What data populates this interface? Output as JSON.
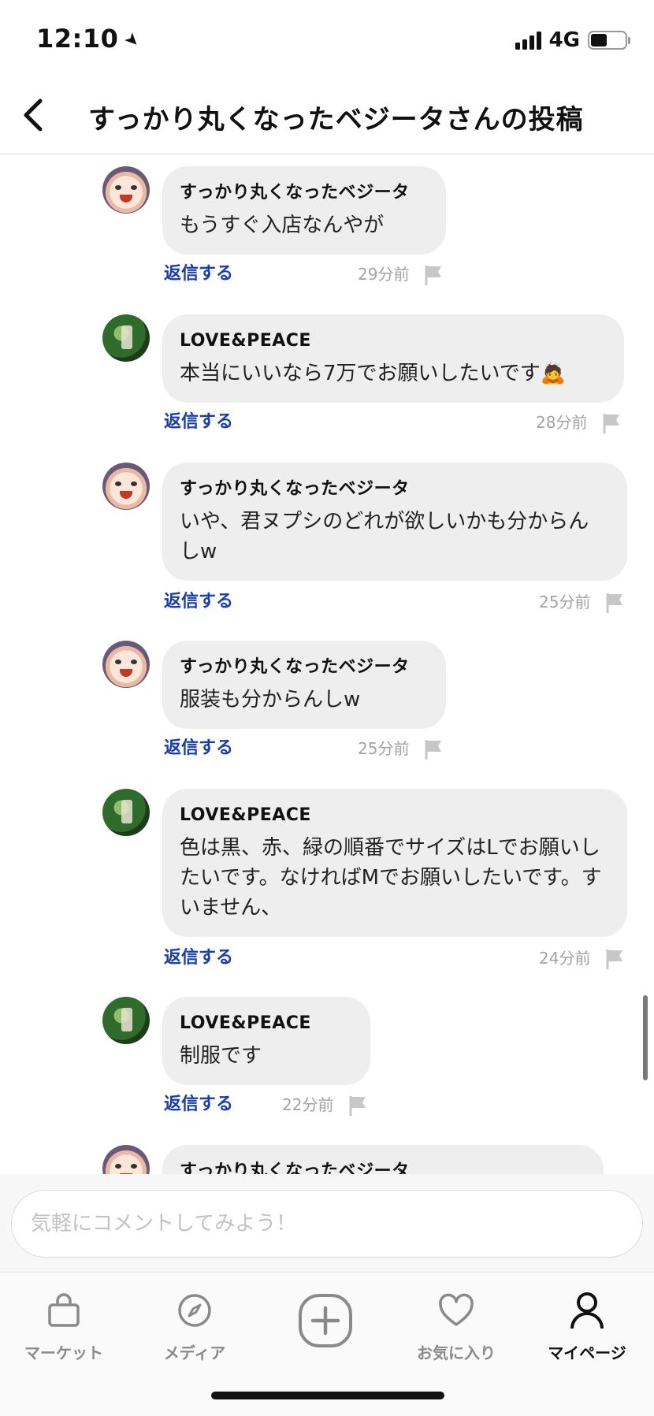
{
  "status_bar": {
    "time": "12:10",
    "network": "4G",
    "battery_level": 0.48
  },
  "header": {
    "title": "すっかり丸くなったベジータさんの投稿"
  },
  "comments": [
    {
      "author": "すっかり丸くなったベジータ",
      "text": "もうすぐ入店なんやが",
      "reply_label": "返信する",
      "time": "29分前",
      "avatar": "vegeta-avatar"
    },
    {
      "author": "LOVE&PEACE",
      "text": "本当にいいなら7万でお願いしたいです🙇",
      "reply_label": "返信する",
      "time": "28分前",
      "avatar": "bottle-avatar"
    },
    {
      "author": "すっかり丸くなったベジータ",
      "text": "いや、君ヌプシのどれが欲しいかも分からんしw",
      "reply_label": "返信する",
      "time": "25分前",
      "avatar": "vegeta-avatar"
    },
    {
      "author": "すっかり丸くなったベジータ",
      "text": "服装も分からんしw",
      "reply_label": "返信する",
      "time": "25分前",
      "avatar": "vegeta-avatar"
    },
    {
      "author": "LOVE&PEACE",
      "text": "色は黒、赤、緑の順番でサイズはLでお願いしたいです。なければMでお願いしたいです。すいません、",
      "reply_label": "返信する",
      "time": "24分前",
      "avatar": "bottle-avatar"
    },
    {
      "author": "LOVE&PEACE",
      "text": "制服です",
      "reply_label": "返信する",
      "time": "22分前",
      "avatar": "bottle-avatar"
    },
    {
      "author": "すっかり丸くなったベジータ",
      "text": "",
      "reply_label": "",
      "time": "",
      "avatar": "vegeta-avatar"
    }
  ],
  "comment_input": {
    "placeholder": "気軽にコメントしてみよう！"
  },
  "tabs": [
    {
      "label": "マーケット",
      "icon": "shopping-bag-icon"
    },
    {
      "label": "メディア",
      "icon": "compass-icon"
    },
    {
      "label": "",
      "icon": "plus-circle-icon"
    },
    {
      "label": "お気に入り",
      "icon": "heart-icon"
    },
    {
      "label": "マイページ",
      "icon": "person-icon"
    }
  ],
  "active_tab": "マイページ",
  "colors": {
    "reply_link": "#1a3ea8",
    "bubble": "#eeeeee",
    "timestamp": "#a3a3a3"
  }
}
